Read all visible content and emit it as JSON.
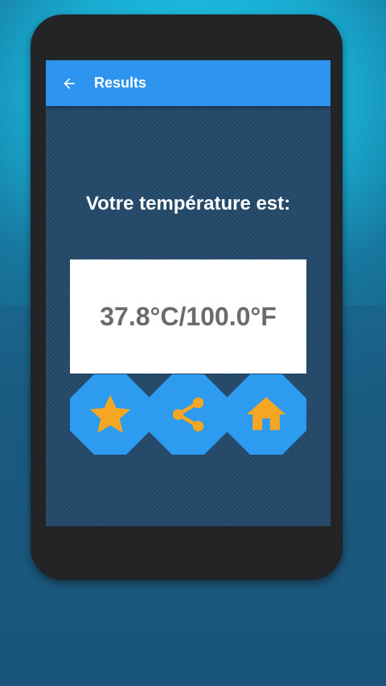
{
  "appbar": {
    "title": "Results",
    "back_icon": "arrow-back-icon"
  },
  "main": {
    "headline": "Votre température est:",
    "result": "37.8°C/100.0°F"
  },
  "actions": [
    {
      "name": "favorite",
      "icon": "star-icon"
    },
    {
      "name": "share",
      "icon": "share-icon"
    },
    {
      "name": "home",
      "icon": "home-icon"
    }
  ],
  "colors": {
    "appbar": "#2f94f0",
    "button": "#2d9bef",
    "icon": "#f5a623",
    "result_text": "#6b6b6b"
  }
}
